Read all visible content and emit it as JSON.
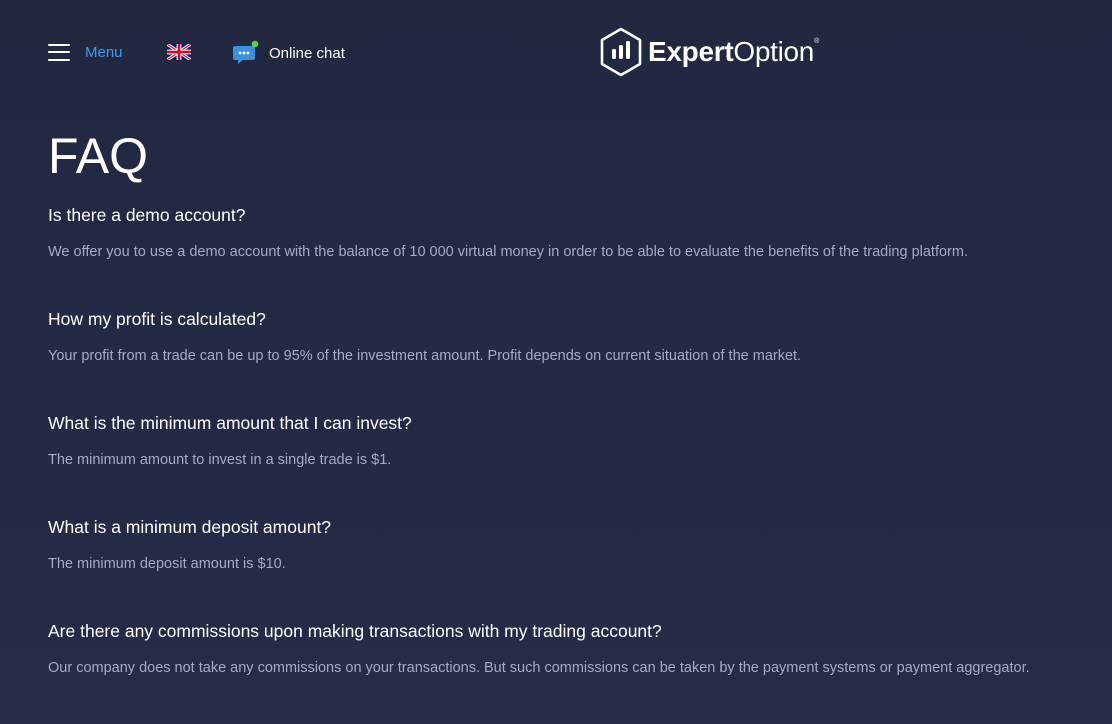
{
  "header": {
    "menu_label": "Menu",
    "language_flag": "uk-flag-icon",
    "chat_label": "Online chat",
    "logo": {
      "bold_part": "Expert",
      "regular_part": "Option",
      "mark": "®"
    }
  },
  "colors": {
    "background": "#222943",
    "accent": "#3d9be9",
    "answer_text": "#a3abc6",
    "chat_indicator": "#5ad045"
  },
  "page_title": "FAQ",
  "faq": [
    {
      "question": "Is there a demo account?",
      "answer": "We offer you to use a demo account with the balance of 10 000 virtual money in order to be able to evaluate the benefits of the trading platform."
    },
    {
      "question": "How my profit is calculated?",
      "answer": "Your profit from a trade can be up to 95% of the investment amount. Profit depends on current situation of the market."
    },
    {
      "question": "What is the minimum amount that I can invest?",
      "answer": "The minimum amount to invest in a single trade is $1."
    },
    {
      "question": "What is a minimum deposit amount?",
      "answer": "The minimum deposit amount is $10."
    },
    {
      "question": "Are there any commissions upon making transactions with my trading account?",
      "answer": "Our company does not take any commissions on your transactions. But such commissions can be taken by the payment systems or payment aggregator."
    }
  ]
}
